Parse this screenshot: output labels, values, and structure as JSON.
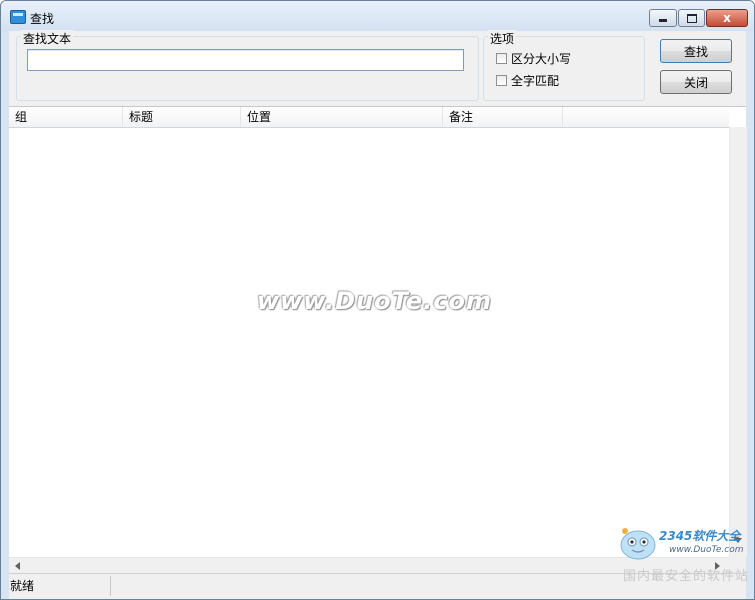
{
  "window": {
    "title": "查找",
    "minimize_label": "",
    "maximize_label": "",
    "close_label": "x"
  },
  "search_group": {
    "label": "查找文本",
    "input_value": ""
  },
  "options_group": {
    "label": "选项",
    "case_sensitive": {
      "label": "区分大小写",
      "checked": false
    },
    "whole_word": {
      "label": "全字匹配",
      "checked": false
    }
  },
  "buttons": {
    "search_label": "查找",
    "close_label": "关闭"
  },
  "list": {
    "columns": [
      "组",
      "标题",
      "位置",
      "备注"
    ],
    "rows": []
  },
  "status": {
    "text": "就绪"
  },
  "watermark": {
    "text": "www.DuoTe.com"
  },
  "logo": {
    "brand": "2345软件大全",
    "url": "www.DuoTe.com",
    "slogan": "国内最安全的软件站"
  },
  "colors": {
    "titlebar": "#d7e4f2",
    "close_button": "#c64b34",
    "accent": "#3c7fb1"
  }
}
